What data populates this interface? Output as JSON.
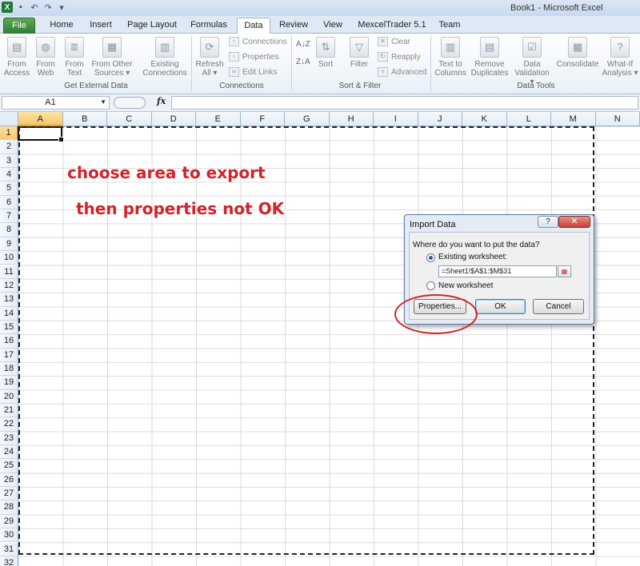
{
  "window": {
    "title": "Book1  -  Microsoft Excel"
  },
  "qat": {
    "logo": "X",
    "undo": "↶",
    "redo": "↷"
  },
  "tabs": [
    {
      "label": "File"
    },
    {
      "label": "Home"
    },
    {
      "label": "Insert"
    },
    {
      "label": "Page Layout"
    },
    {
      "label": "Formulas"
    },
    {
      "label": "Data"
    },
    {
      "label": "Review"
    },
    {
      "label": "View"
    },
    {
      "label": "MexcelTrader 5.1"
    },
    {
      "label": "Team"
    }
  ],
  "ribbon": {
    "get_external": {
      "group": "Get External Data",
      "from_access": "From\nAccess",
      "from_web": "From\nWeb",
      "from_text": "From\nText",
      "from_other": "From Other\nSources ▾",
      "existing": "Existing\nConnections"
    },
    "connections": {
      "group": "Connections",
      "refresh": "Refresh\nAll ▾",
      "connections": "Connections",
      "properties": "Properties",
      "edit_links": "Edit Links"
    },
    "sort_filter": {
      "group": "Sort & Filter",
      "sort": "Sort",
      "filter": "Filter",
      "clear": "Clear",
      "reapply": "Reapply",
      "advanced": "Advanced"
    },
    "data_tools": {
      "group": "Data Tools",
      "text_to_columns": "Text to\nColumns",
      "remove_duplicates": "Remove\nDuplicates",
      "data_validation": "Data\nValidation ▾",
      "consolidate": "Consolidate",
      "what_if": "What-If\nAnalysis ▾"
    }
  },
  "formula_bar": {
    "name_box": "A1",
    "fx": "fx"
  },
  "grid": {
    "columns": [
      "A",
      "B",
      "C",
      "D",
      "E",
      "F",
      "G",
      "H",
      "I",
      "J",
      "K",
      "L",
      "M",
      "N"
    ],
    "rows": [
      "1",
      "2",
      "3",
      "4",
      "5",
      "6",
      "7",
      "8",
      "9",
      "10",
      "11",
      "12",
      "13",
      "14",
      "15",
      "16",
      "17",
      "18",
      "19",
      "20",
      "21",
      "22",
      "23",
      "24",
      "25",
      "26",
      "27",
      "28",
      "29",
      "30",
      "31",
      "32"
    ]
  },
  "annotations": {
    "line1": "choose area to export",
    "line2": "then properties not OK"
  },
  "dialog": {
    "title": "Import Data",
    "help": "?",
    "close": "✕",
    "prompt": "Where do you want to put the data?",
    "existing_label": "Existing worksheet:",
    "reference": "=Sheet1!$A$1:$M$31",
    "new_label": "New worksheet",
    "properties_button": "Properties...",
    "ok_button": "OK",
    "cancel_button": "Cancel"
  }
}
